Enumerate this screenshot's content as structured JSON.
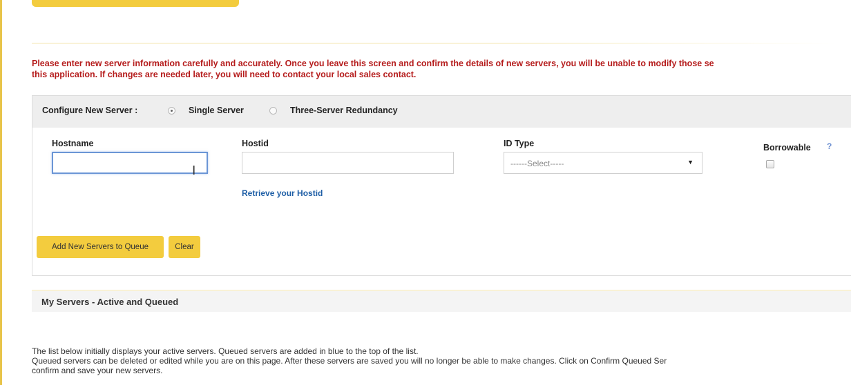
{
  "warning": {
    "line1": "Please enter new server information carefully and accurately. Once you leave this screen and confirm the details of new servers, you will be unable to modify those se",
    "line2": "this application. If changes are needed later, you will need to contact your local sales contact."
  },
  "configure": {
    "label": "Configure New Server :",
    "options": [
      {
        "label": "Single Server",
        "selected": true
      },
      {
        "label": "Three-Server Redundancy",
        "selected": false
      }
    ]
  },
  "form": {
    "hostname": {
      "label": "Hostname",
      "value": ""
    },
    "hostid": {
      "label": "Hostid",
      "value": ""
    },
    "retrieve_link": "Retrieve your Hostid",
    "id_type": {
      "label": "ID Type",
      "selected": "------Select-----"
    },
    "borrowable": {
      "label": "Borrowable",
      "help": "?",
      "checked": false
    }
  },
  "buttons": {
    "add": "Add New Servers to Queue",
    "clear": "Clear"
  },
  "my_servers": {
    "title": "My Servers - Active and Queued",
    "desc_line1": "The list below initially displays your active servers. Queued servers are added in blue to the top of the list.",
    "desc_line2": "Queued servers can be deleted or edited while you are on this page. After these servers are saved you will no longer be able to make changes. Click on Confirm Queued Ser",
    "desc_line3": "confirm and save your new servers."
  },
  "colors": {
    "accent": "#f3cc3e",
    "warning_text": "#b51c1c",
    "link": "#1f5fa6"
  }
}
